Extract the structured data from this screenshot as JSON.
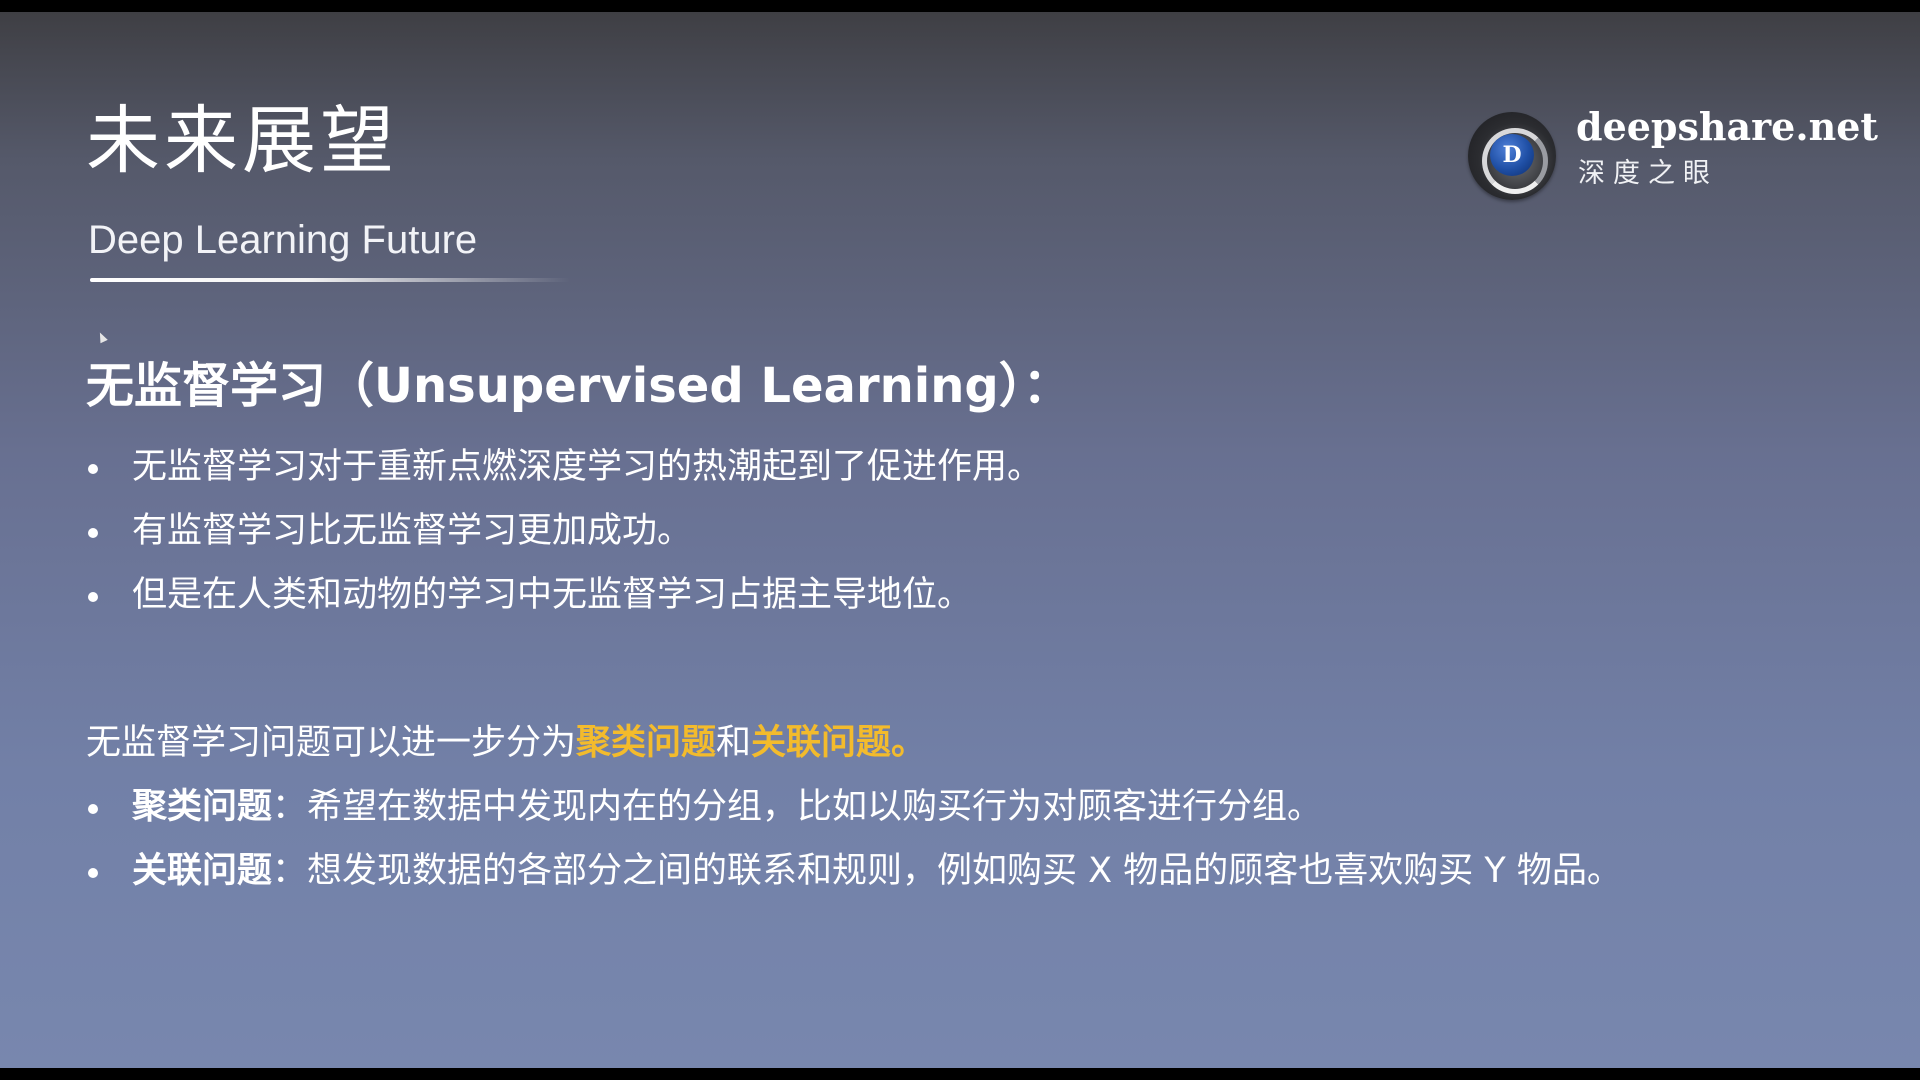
{
  "slide": {
    "title": "未来展望",
    "subtitle": "Deep Learning Future"
  },
  "logo": {
    "site": "deepshare.net",
    "cn_name": "深度之眼",
    "icon_letter": "D",
    "icon": "deepshare-eye-logo"
  },
  "section": {
    "heading": "无监督学习（Unsupervised Learning）："
  },
  "bullets_1": [
    "无监督学习对于重新点燃深度学习的热潮起到了促进作用。",
    "有监督学习比无监督学习更加成功。",
    "但是在人类和动物的学习中无监督学习占据主导地位。"
  ],
  "intro": {
    "prefix": "无监督学习问题可以进一步分为",
    "hl1": "聚类问题",
    "mid": "和",
    "hl2": "关联问题。"
  },
  "bullets_2": [
    {
      "term": "聚类问题",
      "text": "：希望在数据中发现内在的分组，比如以购买行为对顾客进行分组。"
    },
    {
      "term": "关联问题",
      "text": "：想发现数据的各部分之间的联系和规则，例如购买 X 物品的顾客也喜欢购买 Y 物品。"
    }
  ],
  "controls": {
    "prev": "◀",
    "pen": "✎",
    "menu": "≡",
    "zoom": "⊕",
    "next": "▶"
  },
  "colors": {
    "highlight": "#f3bb2c",
    "text": "#ffffff",
    "bg_top": "#3f3f44",
    "bg_bottom": "#7887ae"
  }
}
